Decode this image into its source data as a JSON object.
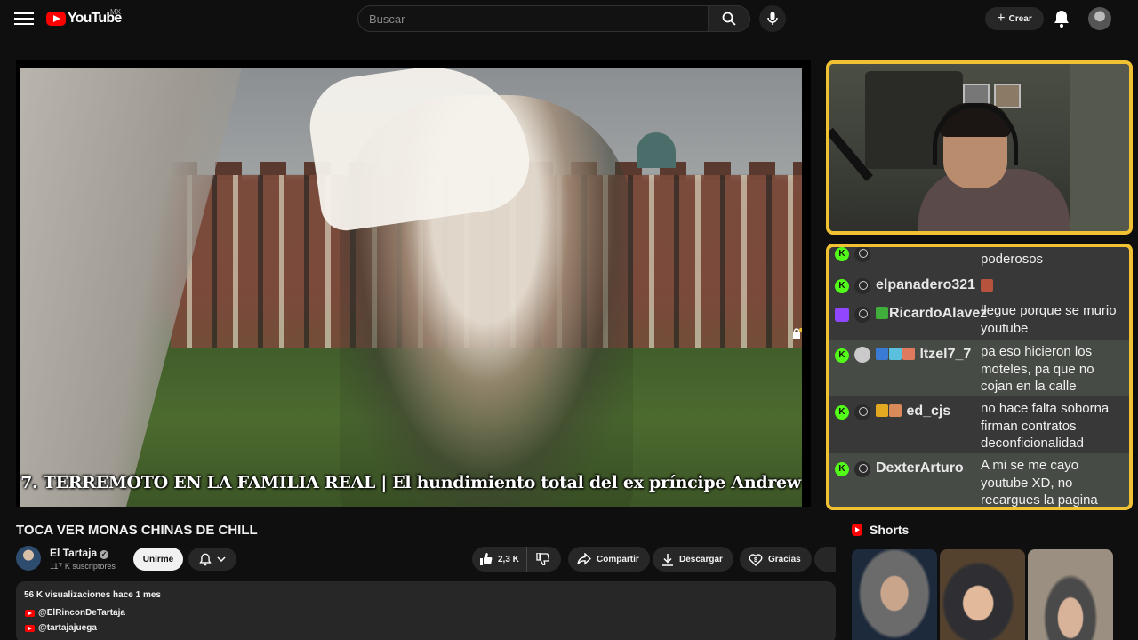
{
  "header": {
    "logo_text": "YouTube",
    "country_code": "MX",
    "search_placeholder": "Buscar",
    "create_label": "Crear"
  },
  "player": {
    "subtitle": "7. TERREMOTO EN LA FAMILIA REAL | El hundimiento total del ex príncipe Andrew"
  },
  "chat": {
    "messages": [
      {
        "user": "",
        "text": "poderosos",
        "platform": "kick"
      },
      {
        "user": "elpanadero321",
        "text": "",
        "platform": "kick",
        "has_emote": true
      },
      {
        "user": "RicardoAlavez",
        "text": "llegue porque se murio youtube",
        "platform": "twitch"
      },
      {
        "user": "ltzel7_7",
        "text": "pa eso hicieron los moteles, pa que no cojan en la calle",
        "platform": "kick"
      },
      {
        "user": "ed_cjs",
        "text": "no hace falta soborna firman contratos deconficionalidad",
        "platform": "kick"
      },
      {
        "user": "DexterArturo",
        "text": "A mi se me cayo youtube XD, no recargues la pagina",
        "platform": "kick"
      }
    ]
  },
  "video": {
    "title": "TOCA VER MONAS CHINAS DE CHILL",
    "channel_name": "El Tartaja",
    "subscribers": "117 K suscriptores",
    "join_label": "Unirme",
    "likes": "2,3 K",
    "share_label": "Compartir",
    "download_label": "Descargar",
    "thanks_label": "Gracias"
  },
  "description": {
    "stats": "56 K visualizaciones  hace 1 mes",
    "links": [
      "@ElRinconDeTartaja",
      "@tartajajuega"
    ]
  },
  "shorts": {
    "title": "Shorts"
  },
  "colors": {
    "background": "#0f0f0f",
    "accent_red": "#ff0000",
    "overlay_border": "#f0c233",
    "kick_green": "#53fc18",
    "twitch_purple": "#9146ff"
  }
}
